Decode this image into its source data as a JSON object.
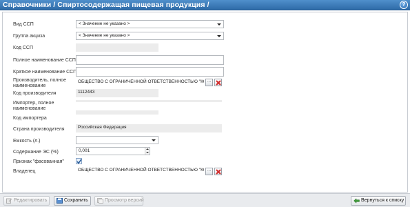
{
  "header": {
    "title": "Справочники / Спиртосодержащая пищевая продукция /",
    "help_label": "?"
  },
  "form": {
    "vid_ssp": {
      "label": "Вид ССП",
      "value": "< Значение не указано >"
    },
    "gruppa_akciza": {
      "label": "Группа акциза",
      "value": "< Значение не указано >"
    },
    "kod_ssp": {
      "label": "Код ССП",
      "value": ""
    },
    "polnoe_naim": {
      "label": "Полное наименование ССП",
      "value": ""
    },
    "kratkoe_naim": {
      "label": "Краткое наименование ССП",
      "value": ""
    },
    "proizvoditel": {
      "label": "Производитель, полное наименование",
      "value": "ОБЩЕСТВО С ОГРАНИЧЕННОЙ ОТВЕТСТВЕННОСТЬЮ \"КОС",
      "pick_label": "..."
    },
    "kod_proizvoditelya": {
      "label": "Код производителя",
      "value": "1112443"
    },
    "importer": {
      "label": "Импортер, полное наименование",
      "value": ""
    },
    "kod_importera": {
      "label": "Код импортера",
      "value": ""
    },
    "strana": {
      "label": "Страна производителя",
      "value": "Российская Федерация"
    },
    "emkost": {
      "label": "Емкость (л.)",
      "value": ""
    },
    "soderzhanie": {
      "label": "Содержание ЭС (%)",
      "value": "0,001"
    },
    "fasovannaya": {
      "label": "Признак \"фасованная\"",
      "checked": true
    },
    "vladelec": {
      "label": "Владелец",
      "value": "ОБЩЕСТВО С ОГРАНИЧЕННОЙ ОТВЕТСТВЕННОСТЬЮ \"КОС",
      "pick_label": "..."
    }
  },
  "toolbar": {
    "edit_label": "Редактировать",
    "save_label": "Сохранить",
    "versions_label": "Просмотр версий",
    "back_label": "Вернуться к списку"
  },
  "icons": {
    "help": "help-icon",
    "delete": "delete-x-icon",
    "checkbox": "checkmark-icon",
    "edit": "edit-icon",
    "save": "save-icon",
    "versions": "versions-icon",
    "back": "back-arrow-icon"
  },
  "colors": {
    "titlebar": "#3a7abb",
    "delete_red": "#d22b2b",
    "checkbox_check": "#2a5d9a"
  }
}
